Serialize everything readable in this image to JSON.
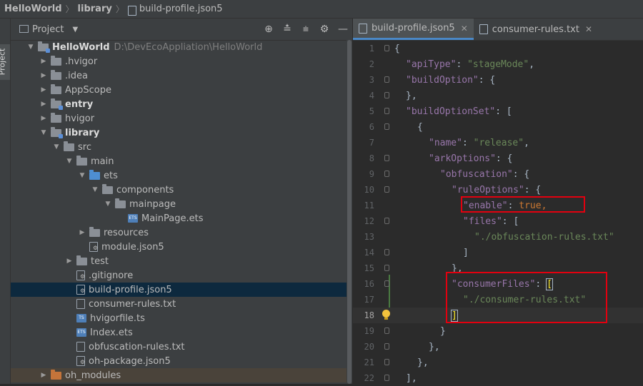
{
  "breadcrumb": [
    "HelloWorld",
    "library",
    "build-profile.json5"
  ],
  "side_stripe": {
    "label": "Project"
  },
  "project_panel": {
    "title": "Project",
    "dropdown_icon": "triangle-down-icon",
    "toolbar_icons": [
      "locate-icon",
      "expand-all-icon",
      "collapse-all-icon",
      "gear-icon",
      "minimize-icon"
    ],
    "tree": [
      {
        "label": "HelloWorld",
        "path": "D:\\DevEcoAppliation\\HelloWorld",
        "indent": 0,
        "arrow": "down",
        "icon": "folder-module",
        "bold": true
      },
      {
        "label": ".hvigor",
        "indent": 1,
        "arrow": "right",
        "icon": "folder"
      },
      {
        "label": ".idea",
        "indent": 1,
        "arrow": "right",
        "icon": "folder"
      },
      {
        "label": "AppScope",
        "indent": 1,
        "arrow": "right",
        "icon": "folder"
      },
      {
        "label": "entry",
        "indent": 1,
        "arrow": "right",
        "icon": "folder-module",
        "bold": true
      },
      {
        "label": "hvigor",
        "indent": 1,
        "arrow": "right",
        "icon": "folder"
      },
      {
        "label": "library",
        "indent": 1,
        "arrow": "down",
        "icon": "folder-module",
        "bold": true
      },
      {
        "label": "src",
        "indent": 2,
        "arrow": "down",
        "icon": "folder"
      },
      {
        "label": "main",
        "indent": 3,
        "arrow": "down",
        "icon": "folder"
      },
      {
        "label": "ets",
        "indent": 4,
        "arrow": "down",
        "icon": "folder-blue"
      },
      {
        "label": "components",
        "indent": 5,
        "arrow": "down",
        "icon": "folder"
      },
      {
        "label": "mainpage",
        "indent": 6,
        "arrow": "down",
        "icon": "folder"
      },
      {
        "label": "MainPage.ets",
        "indent": 7,
        "arrow": "",
        "icon": "ets-file"
      },
      {
        "label": "resources",
        "indent": 4,
        "arrow": "right",
        "icon": "folder"
      },
      {
        "label": "module.json5",
        "indent": 4,
        "arrow": "",
        "icon": "config-file"
      },
      {
        "label": "test",
        "indent": 3,
        "arrow": "right",
        "icon": "folder"
      },
      {
        "label": ".gitignore",
        "indent": 3,
        "arrow": "",
        "icon": "config-file"
      },
      {
        "label": "build-profile.json5",
        "indent": 3,
        "arrow": "",
        "icon": "config-file",
        "selected": true
      },
      {
        "label": "consumer-rules.txt",
        "indent": 3,
        "arrow": "",
        "icon": "text-file"
      },
      {
        "label": "hvigorfile.ts",
        "indent": 3,
        "arrow": "",
        "icon": "ts-file"
      },
      {
        "label": "Index.ets",
        "indent": 3,
        "arrow": "",
        "icon": "ets-file"
      },
      {
        "label": "obfuscation-rules.txt",
        "indent": 3,
        "arrow": "",
        "icon": "text-file"
      },
      {
        "label": "oh-package.json5",
        "indent": 3,
        "arrow": "",
        "icon": "config-file"
      },
      {
        "label": "oh_modules",
        "indent": 1,
        "arrow": "right",
        "icon": "folder-orange",
        "highlight": true
      }
    ]
  },
  "editor": {
    "tabs": [
      {
        "label": "build-profile.json5",
        "active": true,
        "close": "✕"
      },
      {
        "label": "consumer-rules.txt",
        "active": false,
        "close": "✕"
      }
    ],
    "lines": [
      {
        "n": "1",
        "indent": 0,
        "tokens": [
          [
            "p",
            "{"
          ]
        ],
        "fold": true
      },
      {
        "n": "2",
        "indent": 1,
        "tokens": [
          [
            "k",
            "\"apiType\""
          ],
          [
            "p",
            ": "
          ],
          [
            "s",
            "\"stageMode\""
          ],
          [
            "p",
            ","
          ]
        ]
      },
      {
        "n": "3",
        "indent": 1,
        "tokens": [
          [
            "k",
            "\"buildOption\""
          ],
          [
            "p",
            ": {"
          ]
        ],
        "fold": true
      },
      {
        "n": "4",
        "indent": 1,
        "tokens": [
          [
            "p",
            "},"
          ]
        ],
        "fold": true
      },
      {
        "n": "5",
        "indent": 1,
        "tokens": [
          [
            "k",
            "\"buildOptionSet\""
          ],
          [
            "p",
            ": ["
          ]
        ],
        "fold": true
      },
      {
        "n": "6",
        "indent": 2,
        "tokens": [
          [
            "p",
            "{"
          ]
        ],
        "fold": true
      },
      {
        "n": "7",
        "indent": 3,
        "tokens": [
          [
            "k",
            "\"name\""
          ],
          [
            "p",
            ": "
          ],
          [
            "s",
            "\"release\""
          ],
          [
            "p",
            ","
          ]
        ]
      },
      {
        "n": "8",
        "indent": 3,
        "tokens": [
          [
            "k",
            "\"arkOptions\""
          ],
          [
            "p",
            ": {"
          ]
        ],
        "fold": true
      },
      {
        "n": "9",
        "indent": 4,
        "tokens": [
          [
            "k",
            "\"obfuscation\""
          ],
          [
            "p",
            ": {"
          ]
        ],
        "fold": true
      },
      {
        "n": "10",
        "indent": 5,
        "tokens": [
          [
            "k",
            "\"ruleOptions\""
          ],
          [
            "p",
            ": {"
          ]
        ],
        "fold": true
      },
      {
        "n": "11",
        "indent": 6,
        "tokens": [
          [
            "k",
            "\"enable\""
          ],
          [
            "p",
            ": "
          ],
          [
            "kw",
            "true"
          ],
          [
            "kw",
            ","
          ]
        ]
      },
      {
        "n": "12",
        "indent": 6,
        "tokens": [
          [
            "k",
            "\"files\""
          ],
          [
            "p",
            ": ["
          ]
        ],
        "fold": true
      },
      {
        "n": "13",
        "indent": 7,
        "tokens": [
          [
            "s",
            "\"./obfuscation-rules.txt\""
          ]
        ]
      },
      {
        "n": "14",
        "indent": 6,
        "tokens": [
          [
            "p",
            "]"
          ]
        ],
        "fold": true
      },
      {
        "n": "15",
        "indent": 5,
        "tokens": [
          [
            "p",
            "},"
          ]
        ],
        "fold": true
      },
      {
        "n": "16",
        "indent": 5,
        "tokens": [
          [
            "k",
            "\"consumerFiles\""
          ],
          [
            "p",
            ": "
          ],
          [
            "m",
            "["
          ]
        ],
        "fold": true
      },
      {
        "n": "17",
        "indent": 6,
        "tokens": [
          [
            "s",
            "\"./consumer-rules.txt\""
          ]
        ]
      },
      {
        "n": "18",
        "indent": 5,
        "tokens": [
          [
            "m",
            "]"
          ]
        ],
        "fold": true,
        "current": true,
        "bulb": true
      },
      {
        "n": "19",
        "indent": 4,
        "tokens": [
          [
            "p",
            "}"
          ]
        ],
        "fold": true
      },
      {
        "n": "20",
        "indent": 3,
        "tokens": [
          [
            "p",
            "},"
          ]
        ],
        "fold": true
      },
      {
        "n": "21",
        "indent": 2,
        "tokens": [
          [
            "p",
            "},"
          ]
        ],
        "fold": true
      },
      {
        "n": "22",
        "indent": 1,
        "tokens": [
          [
            "p",
            "],"
          ]
        ],
        "fold": true
      }
    ]
  },
  "colors": {
    "accent": "#4a88c7",
    "highlight_box": "#e3000f",
    "selection": "#0d293e",
    "background": "#2b2b2b"
  }
}
